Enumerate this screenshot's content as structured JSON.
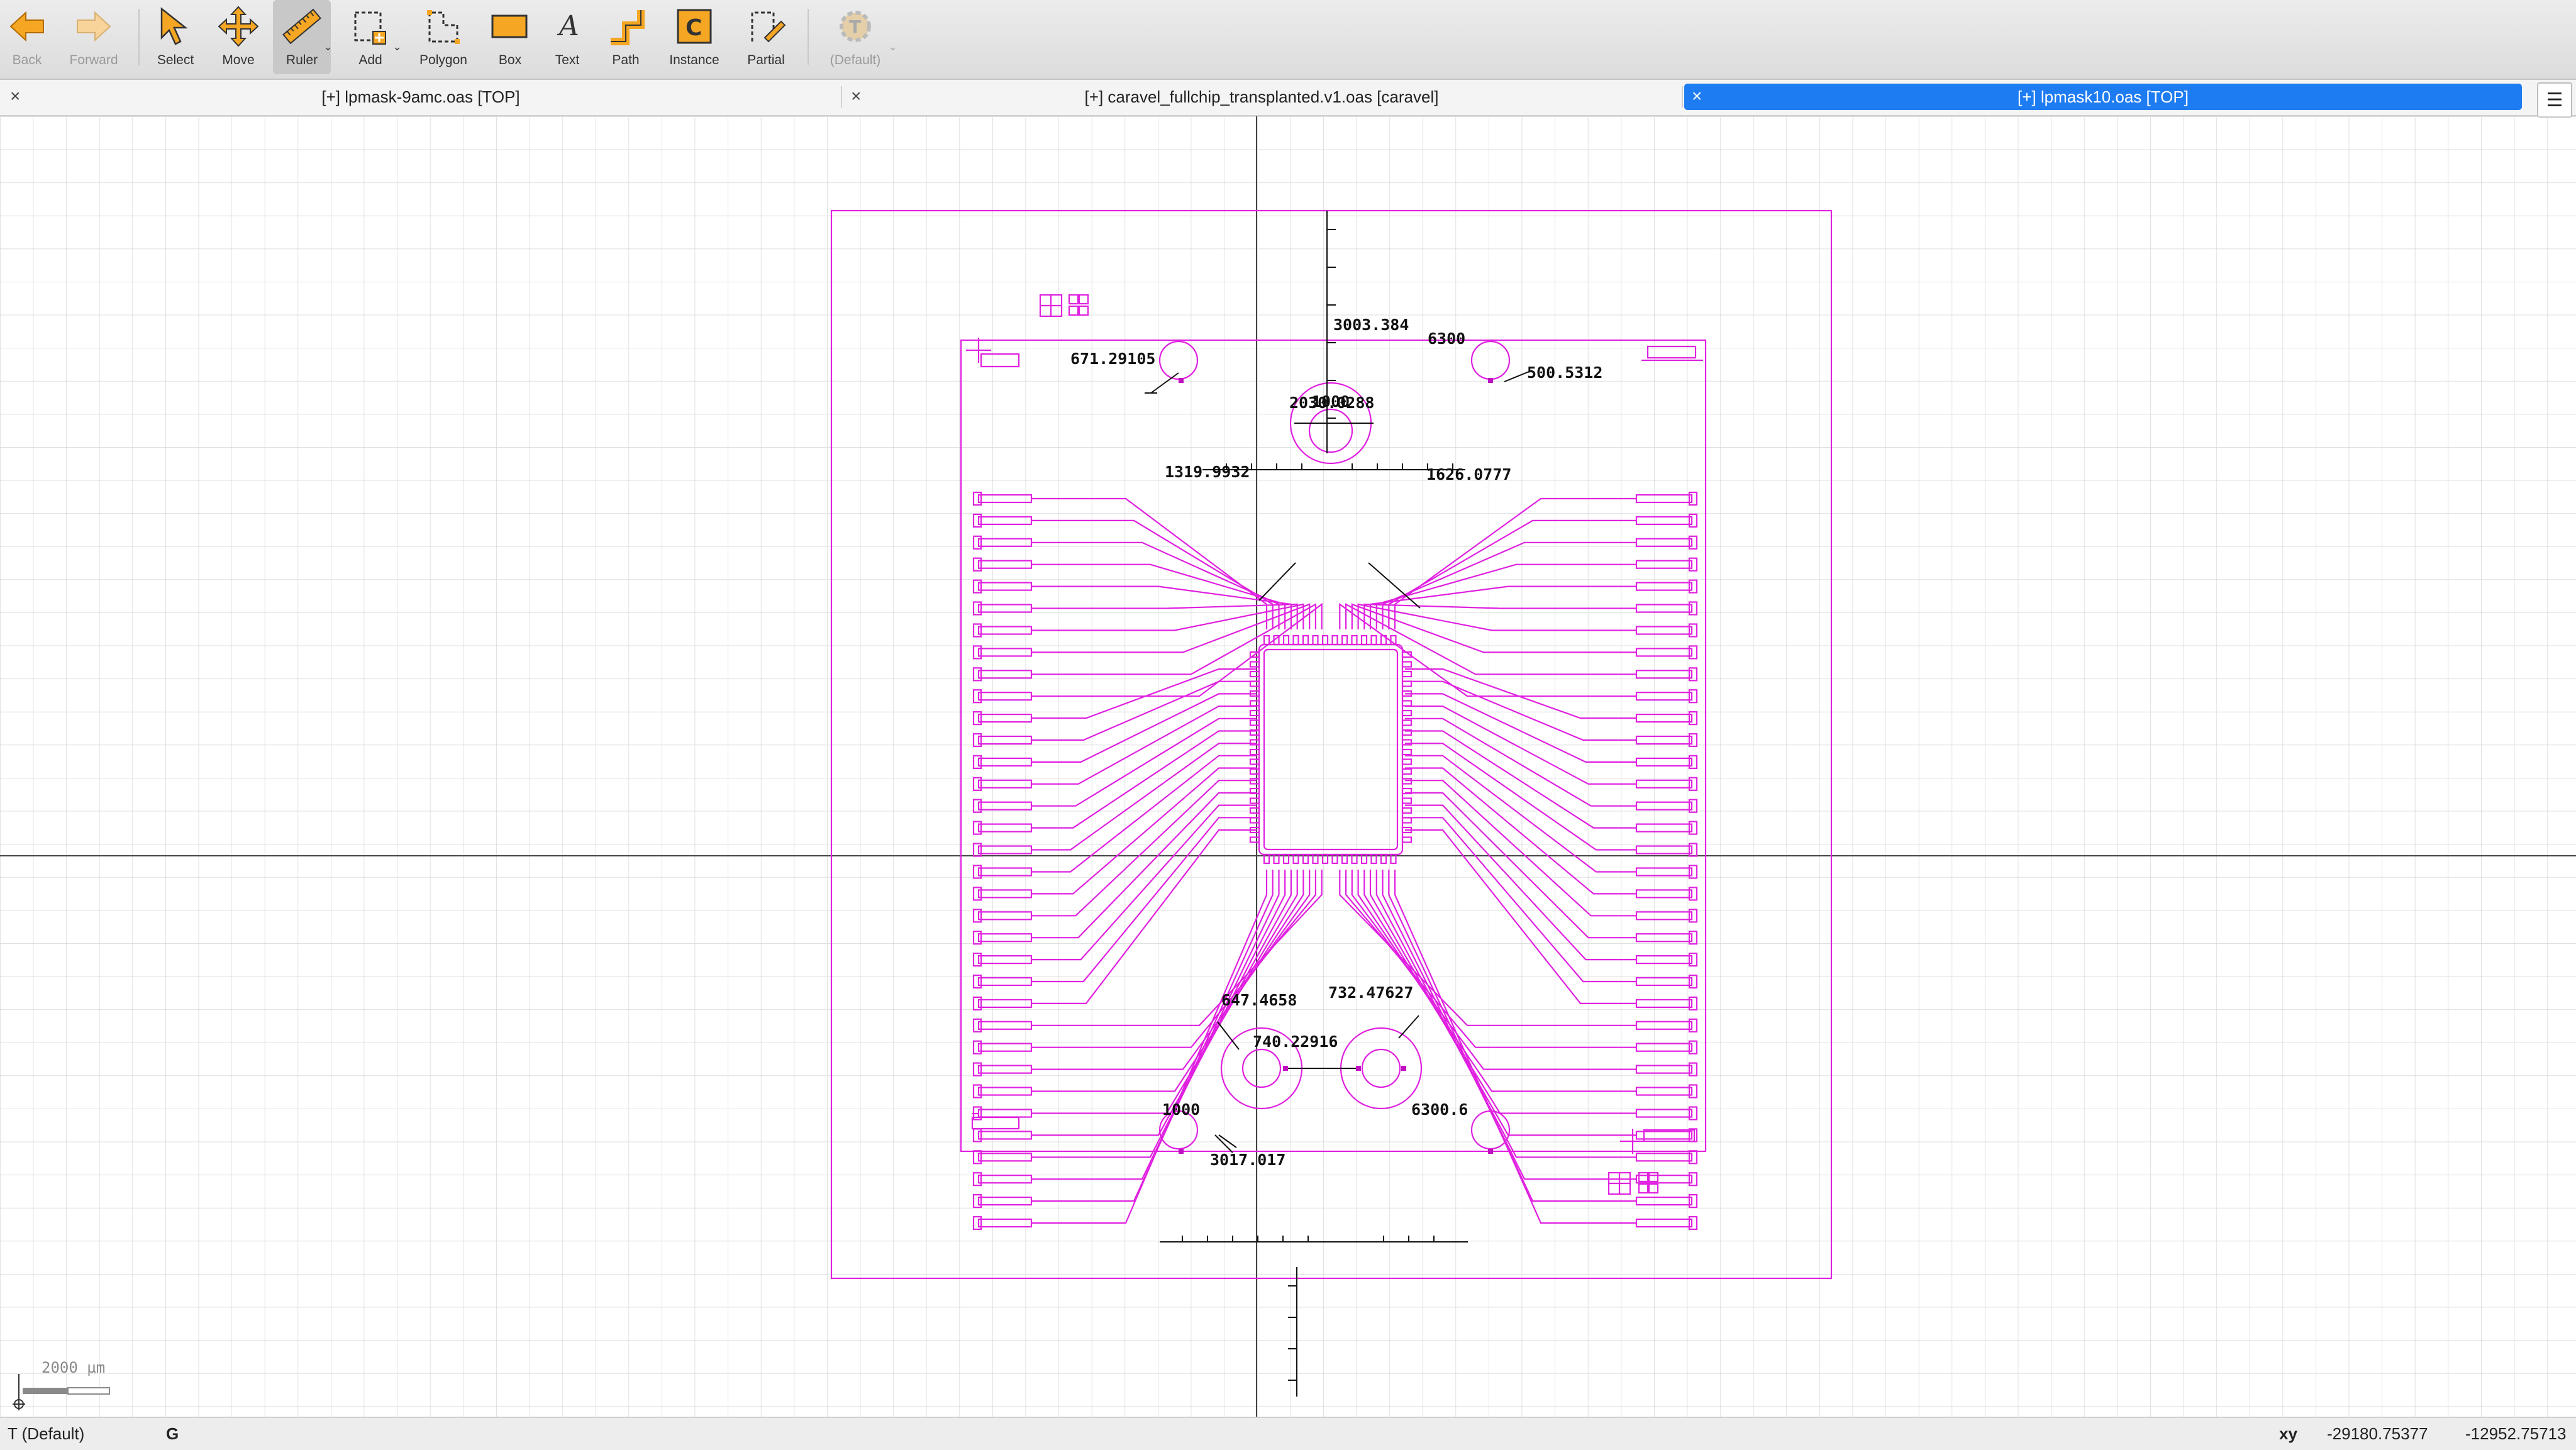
{
  "toolbar": {
    "back": "Back",
    "forward": "Forward",
    "select": "Select",
    "move": "Move",
    "ruler": "Ruler",
    "add": "Add",
    "polygon": "Polygon",
    "box": "Box",
    "text": "Text",
    "path": "Path",
    "instance": "Instance",
    "partial": "Partial",
    "default": "(Default)"
  },
  "tabs": [
    {
      "label": "[+] lpmask-9amc.oas [TOP]",
      "active": false
    },
    {
      "label": "[+] caravel_fullchip_transplanted.v1.oas [caravel]",
      "active": false
    },
    {
      "label": "[+] lpmask10.oas [TOP]",
      "active": true
    }
  ],
  "tab_menu_icon": "hamburger-menu-icon",
  "measurements": {
    "m1": "3003.384",
    "m2": "6300",
    "m3": "671.29105",
    "m4": "500.5312",
    "m5": "2030.0288",
    "m6": "1000",
    "m7": "1319.9932",
    "m8": "1626.0777",
    "m9": "647.4658",
    "m10": "732.47627",
    "m11": "740.22916",
    "m12": "1000",
    "m13": "6300.6",
    "m14": "3017.017"
  },
  "scale_bar": "2000 µm",
  "status": {
    "layer": "T (Default)",
    "grid_mode": "G",
    "coord_mode": "xy",
    "x": "-29180.75377",
    "y": "-12952.75713"
  },
  "colors": {
    "layout_magenta": "#e020e0",
    "accent_blue": "#1e7cf2",
    "grid": "#d9d9d9"
  }
}
